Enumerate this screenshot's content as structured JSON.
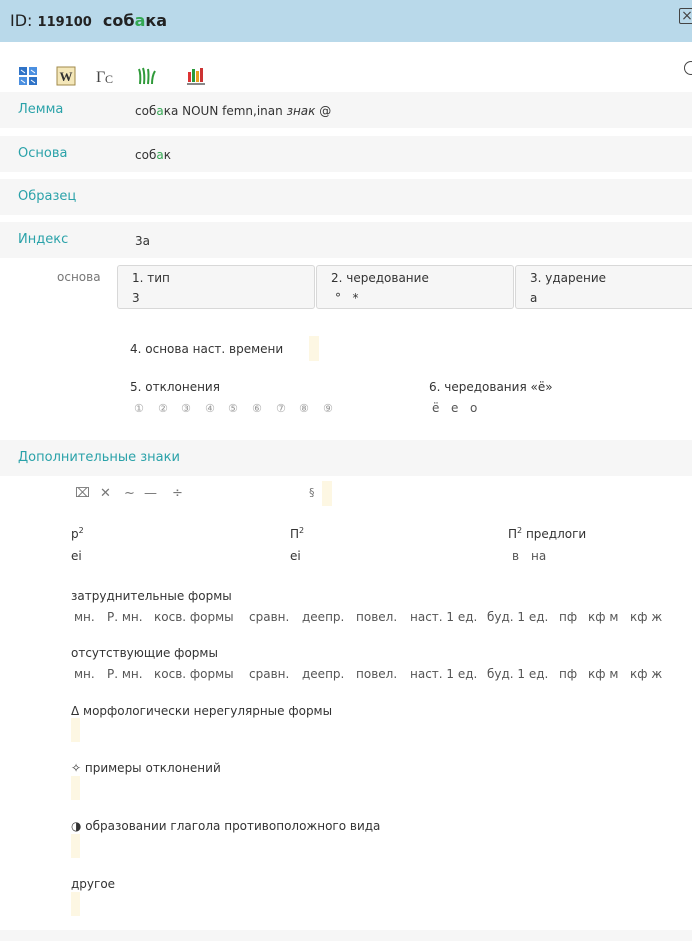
{
  "header": {
    "id_label": "ID:",
    "id_number": "119100",
    "word_pre": "соб",
    "word_accent": "а",
    "word_post": "ка"
  },
  "toolbar": {
    "icons": [
      "wiktionary-icon",
      "wikipedia-icon",
      "gs-icon",
      "grass-icon",
      "nkrya-icon"
    ]
  },
  "fields": {
    "lemma_label": "Лемма",
    "lemma_pre": "соб",
    "lemma_accent": "а",
    "lemma_post": "ка NOUN femn,inan",
    "lemma_znak": "знак",
    "lemma_at": "@",
    "osnova_label": "Основа",
    "osnova_pre": "соб",
    "osnova_accent": "а",
    "osnova_post": "к",
    "obrazec_label": "Образец",
    "index_label": "Индекс",
    "index_value": "3а"
  },
  "osnova_section": {
    "label": "основа",
    "boxes": [
      {
        "title": "1. тип",
        "value": "3"
      },
      {
        "title": "2. чередование",
        "value": "°   *"
      },
      {
        "title": "3. ударение",
        "value": "а"
      }
    ],
    "present_stem_label": "4. основа наст. времени",
    "deviations_label": "5. отклонения",
    "deviations": [
      "①",
      "②",
      "③",
      "④",
      "⑤",
      "⑥",
      "⑦",
      "⑧",
      "⑨"
    ],
    "yo_label": "6. чередования «ё»",
    "yo_options": [
      "ё",
      "е",
      "о"
    ]
  },
  "extra": {
    "section_label": "Дополнительные знаки",
    "symbols": [
      "⌧",
      "✕",
      "~",
      "—",
      "÷"
    ],
    "paragraph": "§",
    "r2_label": "р",
    "r2_sup": "2",
    "r2_value": "еі",
    "p2_label": "П",
    "p2_sup": "2",
    "p2_value": "еі",
    "p2prep_label": "П",
    "p2prep_sup": "2",
    "p2prep_text": " предлоги",
    "prepositions": [
      "в",
      "на"
    ],
    "difficult_label": "затруднительные формы",
    "difficult_forms": [
      "мн.",
      "Р. мн.",
      "косв. формы",
      "сравн.",
      "деепр.",
      "повел.",
      "наст. 1 ед.",
      "буд. 1 ед.",
      "пф",
      "кф м",
      "кф ж"
    ],
    "missing_label": "отсутствующие формы",
    "missing_forms": [
      "мн.",
      "Р. мн.",
      "косв. формы",
      "сравн.",
      "деепр.",
      "повел.",
      "наст. 1 ед.",
      "буд. 1 ед.",
      "пф",
      "кф м",
      "кф ж"
    ],
    "irregular_label": "Δ морфологически нерегулярные формы",
    "examples_label": "✧ примеры отклонений",
    "aspect_label": "◑ образовании глагола противоположного вида",
    "other_label": "другое"
  },
  "colors": {
    "header_bg": "#b9d9ea",
    "teal": "#2aa2a9",
    "accent_green": "#34a853",
    "row_bg": "#f6f6f6",
    "cream": "#fdf7e3"
  }
}
